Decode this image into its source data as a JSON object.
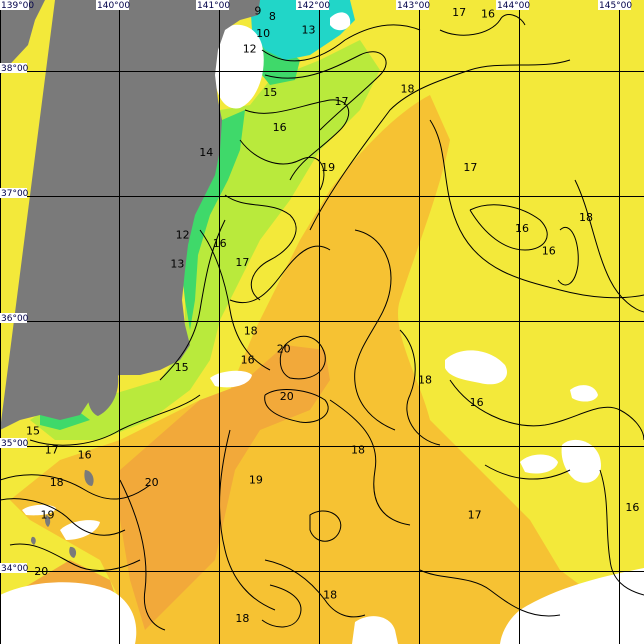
{
  "map": {
    "colors": {
      "land": "#7a7a7a",
      "no_data": "#ffffff",
      "sea_cold": "#21d6c8",
      "sea_cool": "#3fd96a",
      "sea_mild": "#b9ea3c",
      "sea_warm": "#f3e93a",
      "sea_warmer": "#f6c233",
      "sea_hot": "#f2a93a",
      "contour": "#000000",
      "grid": "#000000",
      "coord_text": "#00004a"
    },
    "longitude_labels": [
      "139°00",
      "140°00",
      "141°00",
      "142°00",
      "143°00",
      "144°00",
      "145°00"
    ],
    "latitude_labels": [
      "38°00",
      "37°00",
      "36°00",
      "35°00",
      "34°00"
    ],
    "isotherm_labels": [
      {
        "text": "9",
        "lon": 141.5,
        "lat": 38.45
      },
      {
        "text": "8",
        "lon": 141.64,
        "lat": 38.41
      },
      {
        "text": "10",
        "lon": 141.55,
        "lat": 38.27
      },
      {
        "text": "12",
        "lon": 141.42,
        "lat": 38.15
      },
      {
        "text": "13",
        "lon": 141.99,
        "lat": 38.3
      },
      {
        "text": "17",
        "lon": 143.45,
        "lat": 38.44
      },
      {
        "text": "16",
        "lon": 143.73,
        "lat": 38.43
      },
      {
        "text": "18",
        "lon": 142.95,
        "lat": 37.83
      },
      {
        "text": "15",
        "lon": 141.62,
        "lat": 37.8
      },
      {
        "text": "17",
        "lon": 142.31,
        "lat": 37.73
      },
      {
        "text": "16",
        "lon": 141.71,
        "lat": 37.52
      },
      {
        "text": "14",
        "lon": 141.0,
        "lat": 37.32
      },
      {
        "text": "19",
        "lon": 142.18,
        "lat": 37.2
      },
      {
        "text": "17",
        "lon": 143.56,
        "lat": 37.2
      },
      {
        "text": "18",
        "lon": 144.68,
        "lat": 36.8
      },
      {
        "text": "16",
        "lon": 144.06,
        "lat": 36.71
      },
      {
        "text": "12",
        "lon": 140.77,
        "lat": 36.66
      },
      {
        "text": "16",
        "lon": 141.13,
        "lat": 36.59
      },
      {
        "text": "16",
        "lon": 144.32,
        "lat": 36.53
      },
      {
        "text": "13",
        "lon": 140.72,
        "lat": 36.43
      },
      {
        "text": "17",
        "lon": 141.35,
        "lat": 36.44
      },
      {
        "text": "18",
        "lon": 141.43,
        "lat": 35.89
      },
      {
        "text": "20",
        "lon": 141.75,
        "lat": 35.75
      },
      {
        "text": "16",
        "lon": 141.4,
        "lat": 35.66
      },
      {
        "text": "15",
        "lon": 140.76,
        "lat": 35.6
      },
      {
        "text": "18",
        "lon": 143.12,
        "lat": 35.5
      },
      {
        "text": "20",
        "lon": 141.78,
        "lat": 35.37
      },
      {
        "text": "16",
        "lon": 143.62,
        "lat": 35.32
      },
      {
        "text": "15",
        "lon": 139.32,
        "lat": 35.09
      },
      {
        "text": "17",
        "lon": 139.5,
        "lat": 34.94
      },
      {
        "text": "16",
        "lon": 139.82,
        "lat": 34.9
      },
      {
        "text": "18",
        "lon": 142.47,
        "lat": 34.94
      },
      {
        "text": "18",
        "lon": 139.55,
        "lat": 34.68
      },
      {
        "text": "20",
        "lon": 140.47,
        "lat": 34.68
      },
      {
        "text": "19",
        "lon": 141.48,
        "lat": 34.7
      },
      {
        "text": "19",
        "lon": 139.46,
        "lat": 34.42
      },
      {
        "text": "17",
        "lon": 143.6,
        "lat": 34.42
      },
      {
        "text": "16",
        "lon": 145.13,
        "lat": 34.48
      },
      {
        "text": "20",
        "lon": 139.4,
        "lat": 33.97
      },
      {
        "text": "18",
        "lon": 142.2,
        "lat": 33.78
      },
      {
        "text": "18",
        "lon": 141.35,
        "lat": 33.59
      }
    ]
  }
}
